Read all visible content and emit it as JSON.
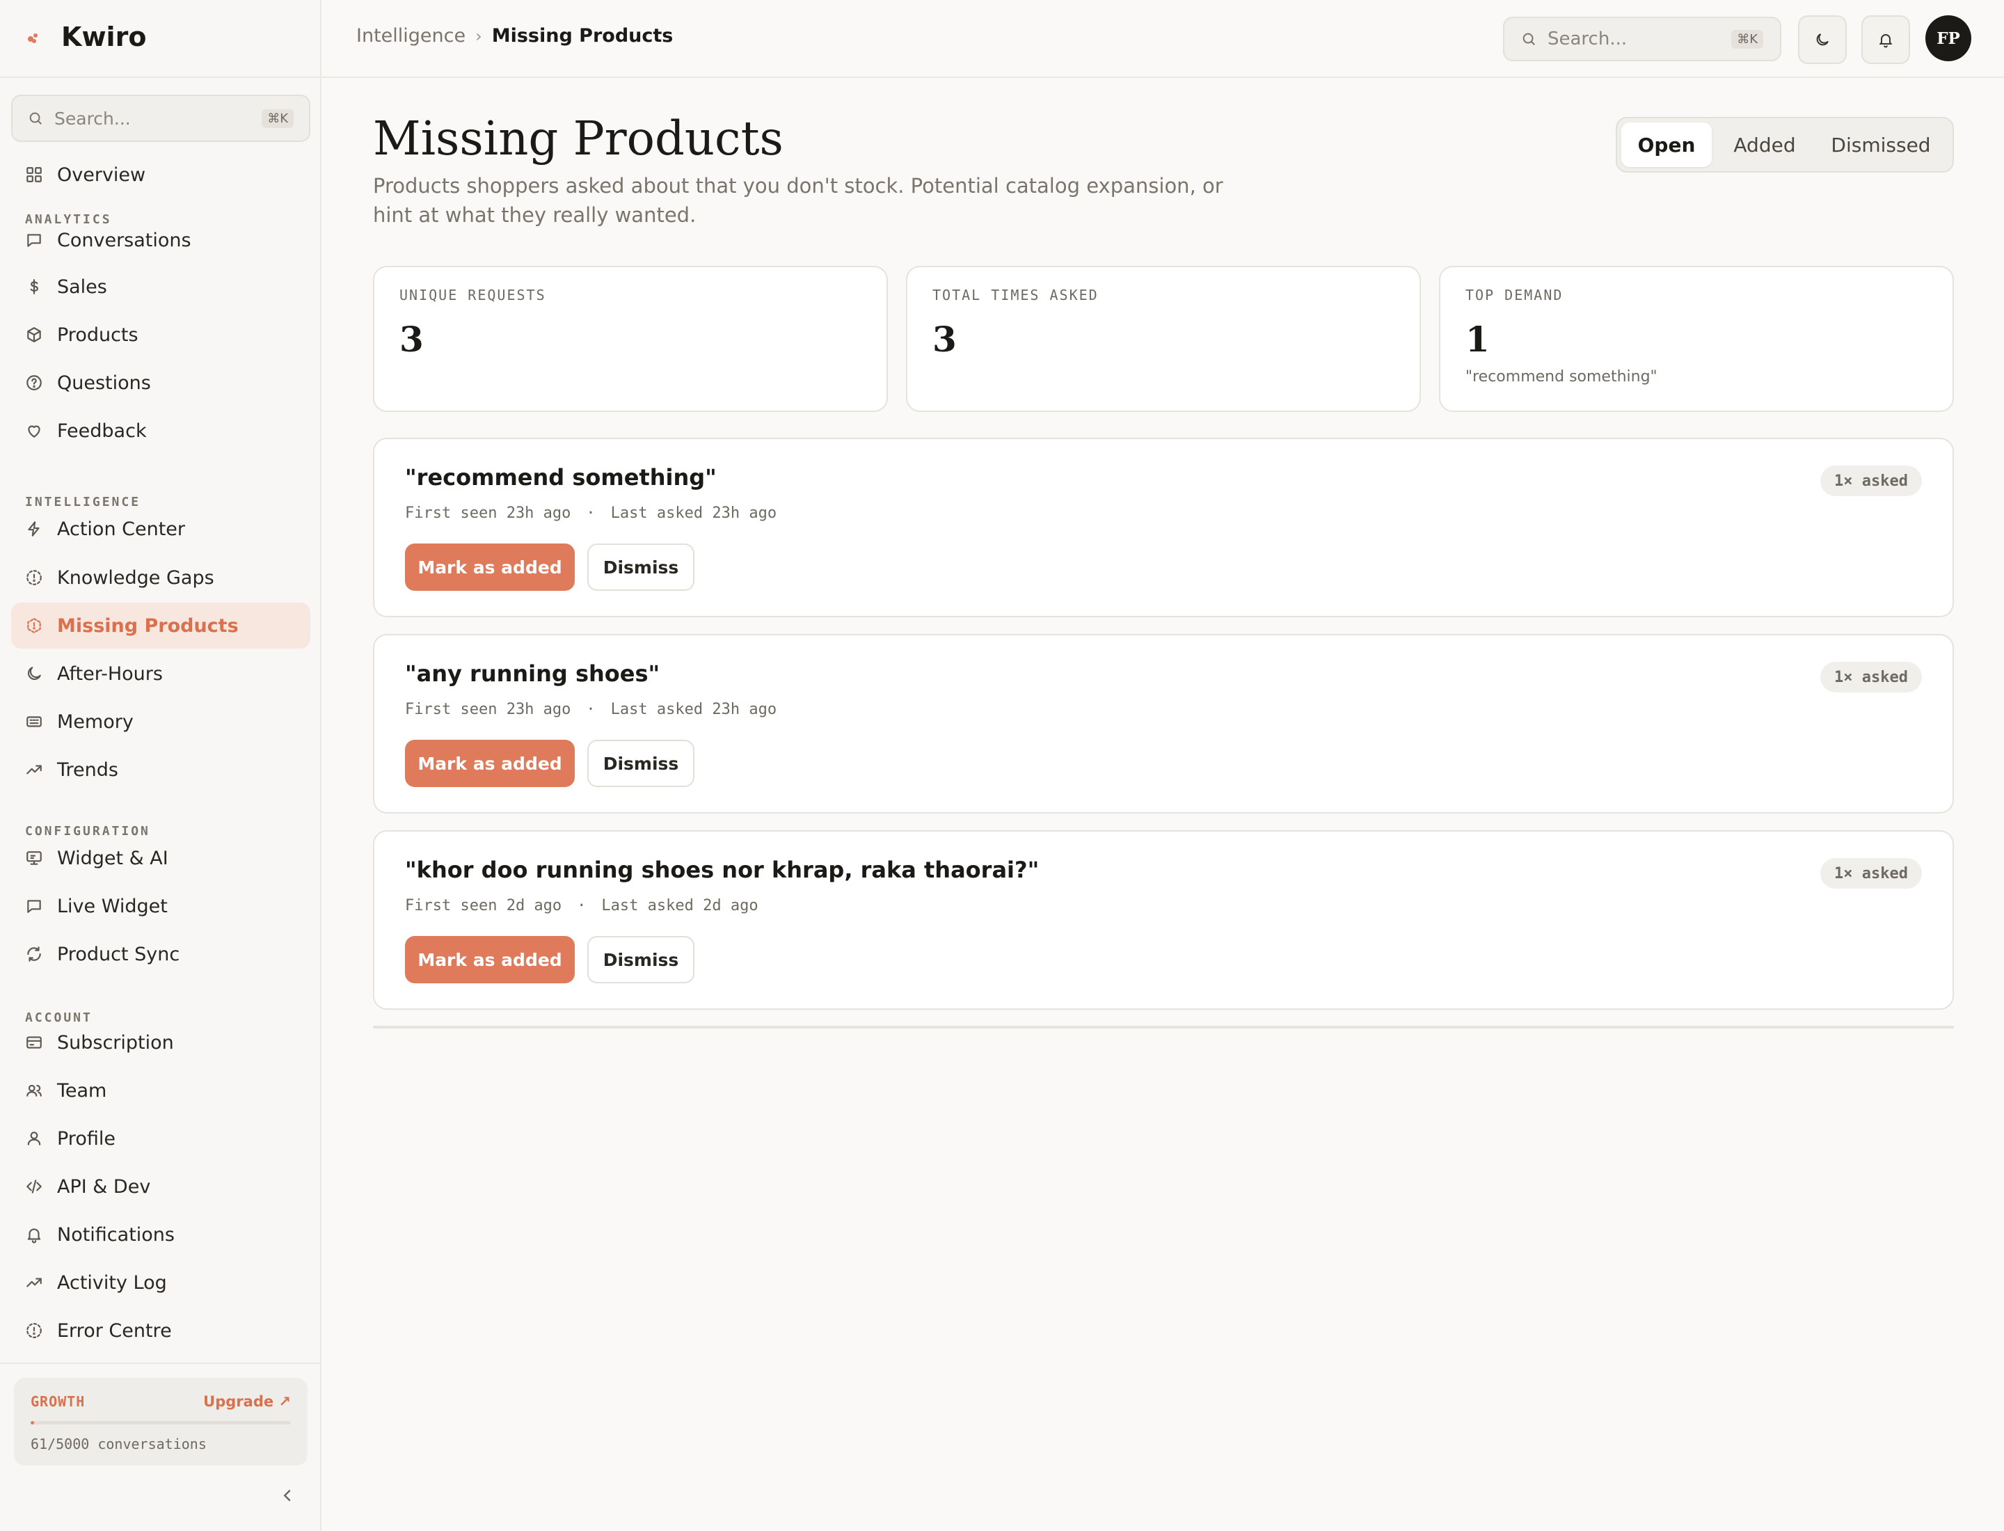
{
  "brand": {
    "name": "Kwiro"
  },
  "sidebar": {
    "search": {
      "placeholder": "Search...",
      "shortcut": "⌘K"
    },
    "overview": {
      "label": "Overview",
      "icon": "grid-icon"
    },
    "sections": [
      {
        "title": "ANALYTICS",
        "items": [
          {
            "label": "Conversations",
            "icon": "chat-icon"
          },
          {
            "label": "Sales",
            "icon": "dollar-icon"
          },
          {
            "label": "Products",
            "icon": "box-icon"
          },
          {
            "label": "Questions",
            "icon": "question-icon"
          },
          {
            "label": "Feedback",
            "icon": "heart-icon"
          }
        ]
      },
      {
        "title": "INTELLIGENCE",
        "items": [
          {
            "label": "Action Center",
            "icon": "bolt-icon"
          },
          {
            "label": "Knowledge Gaps",
            "icon": "dashed-circle-icon"
          },
          {
            "label": "Missing Products",
            "icon": "hexagon-icon",
            "active": true
          },
          {
            "label": "After-Hours",
            "icon": "moon-icon"
          },
          {
            "label": "Memory",
            "icon": "memory-icon"
          },
          {
            "label": "Trends",
            "icon": "trend-icon"
          }
        ]
      },
      {
        "title": "CONFIGURATION",
        "items": [
          {
            "label": "Widget & AI",
            "icon": "monitor-icon"
          },
          {
            "label": "Live Widget",
            "icon": "chat-icon"
          },
          {
            "label": "Product Sync",
            "icon": "sync-icon"
          }
        ]
      },
      {
        "title": "ACCOUNT",
        "items": [
          {
            "label": "Subscription",
            "icon": "card-icon"
          },
          {
            "label": "Team",
            "icon": "users-icon"
          },
          {
            "label": "Profile",
            "icon": "user-icon"
          },
          {
            "label": "API & Dev",
            "icon": "code-icon"
          },
          {
            "label": "Notifications",
            "icon": "bell-icon"
          },
          {
            "label": "Activity Log",
            "icon": "trend-icon"
          },
          {
            "label": "Error Centre",
            "icon": "alert-icon"
          }
        ]
      }
    ],
    "plan": {
      "name": "GROWTH",
      "upgrade": "Upgrade ↗",
      "usage": "61/5000 conversations",
      "used": 61,
      "limit": 5000
    }
  },
  "topbar": {
    "breadcrumb": {
      "parent": "Intelligence",
      "separator": "›",
      "current": "Missing Products"
    },
    "search": {
      "placeholder": "Search...",
      "shortcut": "⌘K"
    },
    "avatar": "FP"
  },
  "page": {
    "title": "Missing Products",
    "subtitle": "Products shoppers asked about that you don't stock. Potential catalog expansion, or hint at what they really wanted.",
    "tabs": [
      {
        "label": "Open",
        "active": true
      },
      {
        "label": "Added",
        "active": false
      },
      {
        "label": "Dismissed",
        "active": false
      }
    ]
  },
  "stats": [
    {
      "label": "UNIQUE REQUESTS",
      "value": "3",
      "note": ""
    },
    {
      "label": "TOTAL TIMES ASKED",
      "value": "3",
      "note": ""
    },
    {
      "label": "TOP DEMAND",
      "value": "1",
      "note": "\"recommend something\""
    }
  ],
  "requests": [
    {
      "title": "\"recommend something\"",
      "first_seen": "First seen 23h ago",
      "dot": "·",
      "last_asked": "Last asked 23h ago",
      "badge": "1× asked",
      "primary": "Mark as added",
      "secondary": "Dismiss"
    },
    {
      "title": "\"any running shoes\"",
      "first_seen": "First seen 23h ago",
      "dot": "·",
      "last_asked": "Last asked 23h ago",
      "badge": "1× asked",
      "primary": "Mark as added",
      "secondary": "Dismiss"
    },
    {
      "title": "\"khor doo running shoes nor khrap, raka thaorai?\"",
      "first_seen": "First seen 2d ago",
      "dot": "·",
      "last_asked": "Last asked 2d ago",
      "badge": "1× asked",
      "primary": "Mark as added",
      "secondary": "Dismiss"
    }
  ]
}
